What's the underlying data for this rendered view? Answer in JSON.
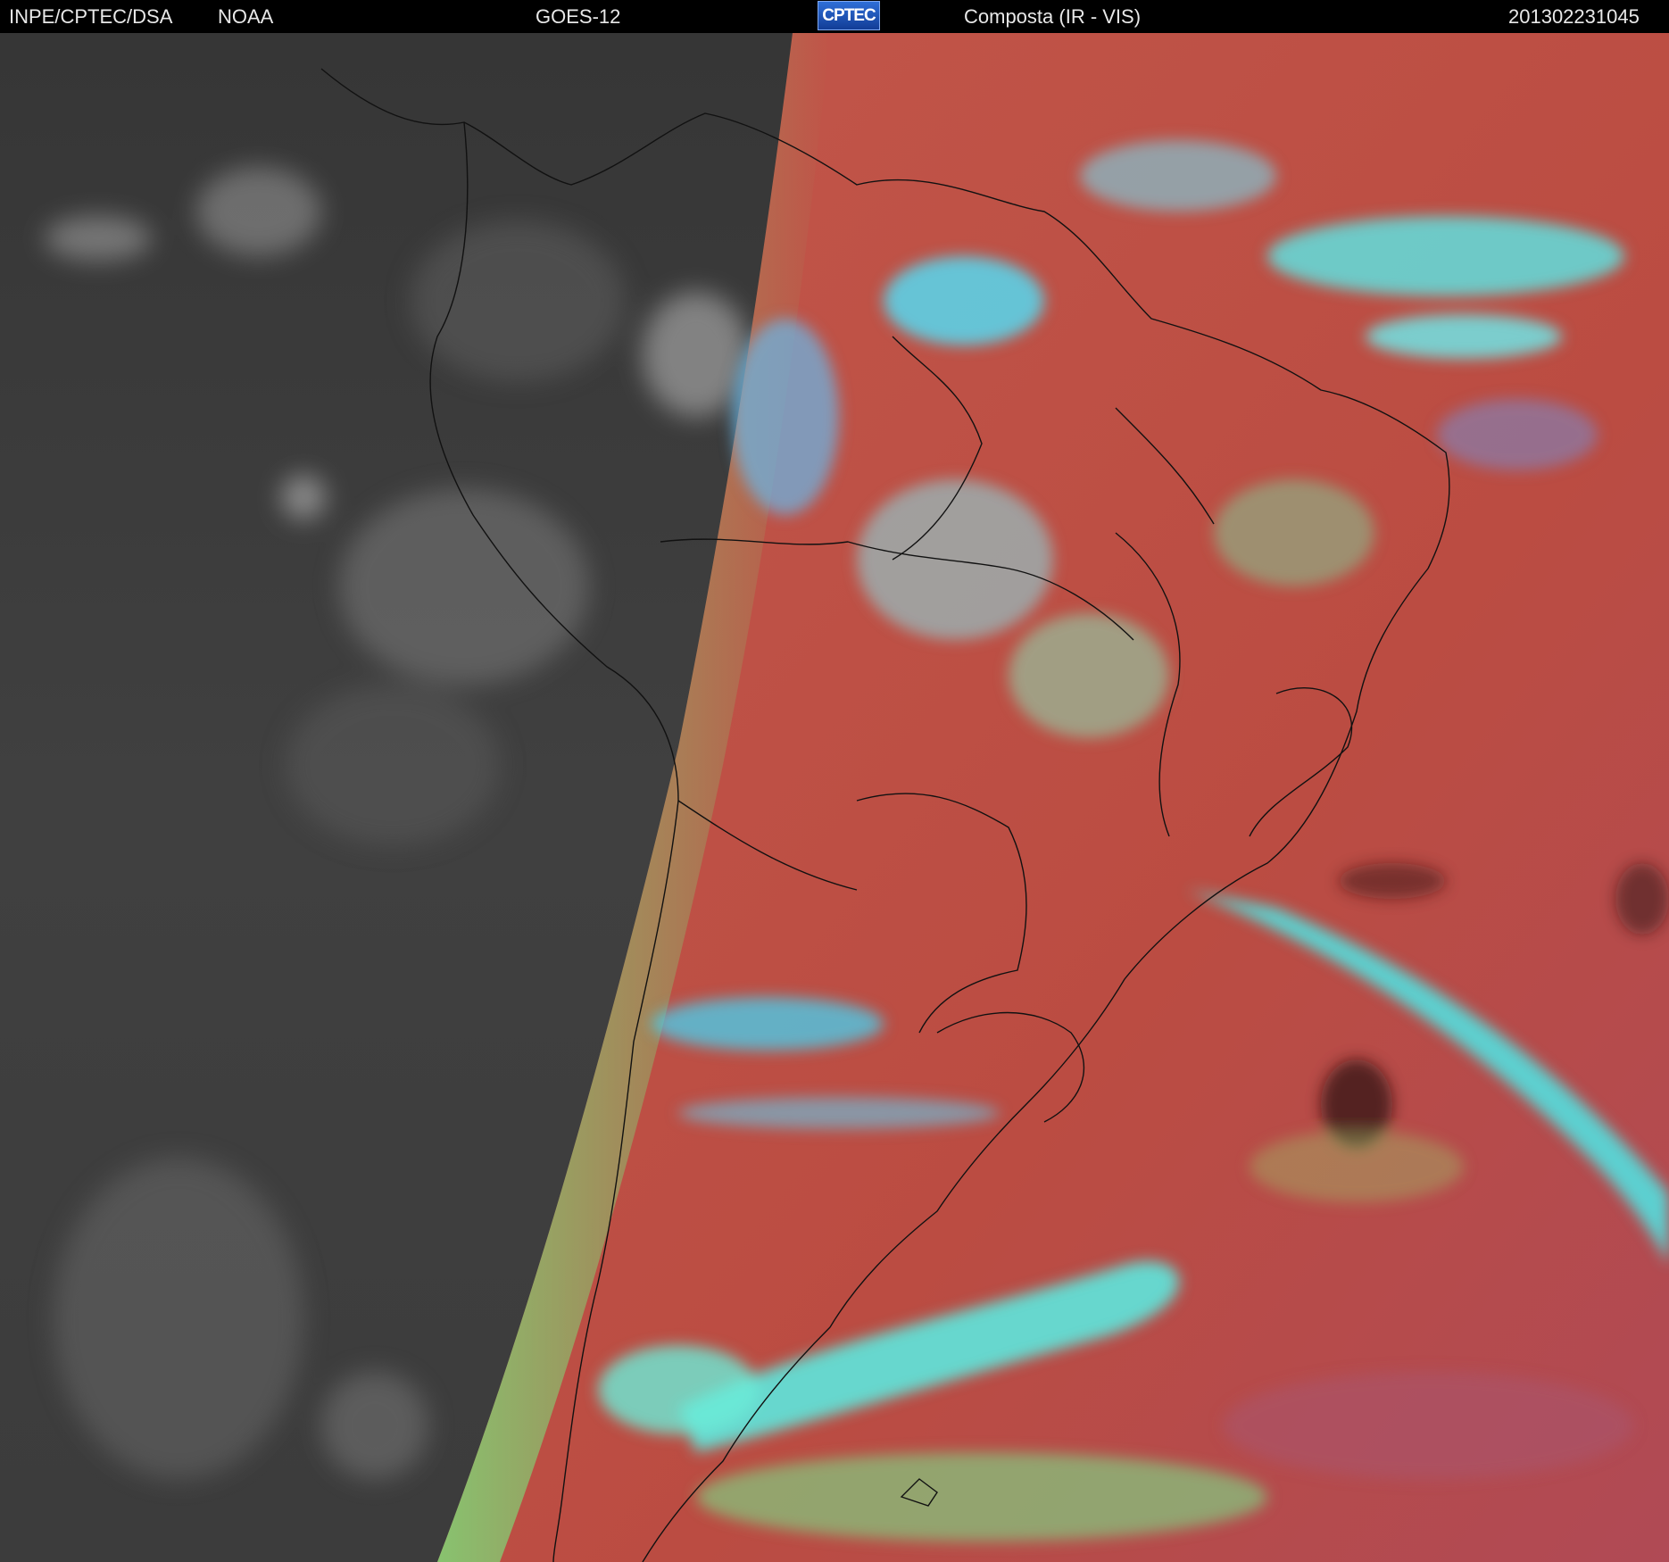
{
  "header": {
    "org": "INPE/CPTEC/DSA",
    "agency": "NOAA",
    "satellite": "GOES-12",
    "logo_text": "CPTEC",
    "product": "Composta (IR - VIS)",
    "timestamp": "201302231045"
  },
  "colors": {
    "night_side": "#3a3a3a",
    "day_ocean": "#c0534a",
    "land_red": "#b8483f",
    "cloud_cyan": "#4fe6e6",
    "cloud_green": "#7fe07a",
    "coastline": "#111111"
  }
}
